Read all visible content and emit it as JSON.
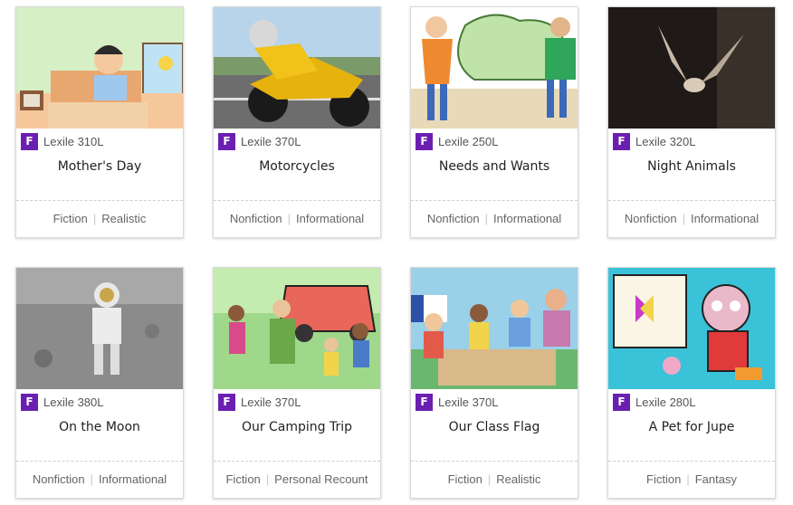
{
  "books": [
    {
      "level": "F",
      "lexile": "Lexile 310L",
      "title": "Mother's Day",
      "genre": "Fiction",
      "subgenre": "Realistic"
    },
    {
      "level": "F",
      "lexile": "Lexile 370L",
      "title": "Motorcycles",
      "genre": "Nonfiction",
      "subgenre": "Informational"
    },
    {
      "level": "F",
      "lexile": "Lexile 250L",
      "title": "Needs and Wants",
      "genre": "Nonfiction",
      "subgenre": "Informational"
    },
    {
      "level": "F",
      "lexile": "Lexile 320L",
      "title": "Night Animals",
      "genre": "Nonfiction",
      "subgenre": "Informational"
    },
    {
      "level": "F",
      "lexile": "Lexile 380L",
      "title": "On the Moon",
      "genre": "Nonfiction",
      "subgenre": "Informational"
    },
    {
      "level": "F",
      "lexile": "Lexile 370L",
      "title": "Our Camping Trip",
      "genre": "Fiction",
      "subgenre": "Personal Recount"
    },
    {
      "level": "F",
      "lexile": "Lexile 370L",
      "title": "Our Class Flag",
      "genre": "Fiction",
      "subgenre": "Realistic"
    },
    {
      "level": "F",
      "lexile": "Lexile 280L",
      "title": "A Pet for Jupe",
      "genre": "Fiction",
      "subgenre": "Fantasy"
    }
  ],
  "separator": "|",
  "colors": {
    "level_badge": "#6b1fb1"
  }
}
